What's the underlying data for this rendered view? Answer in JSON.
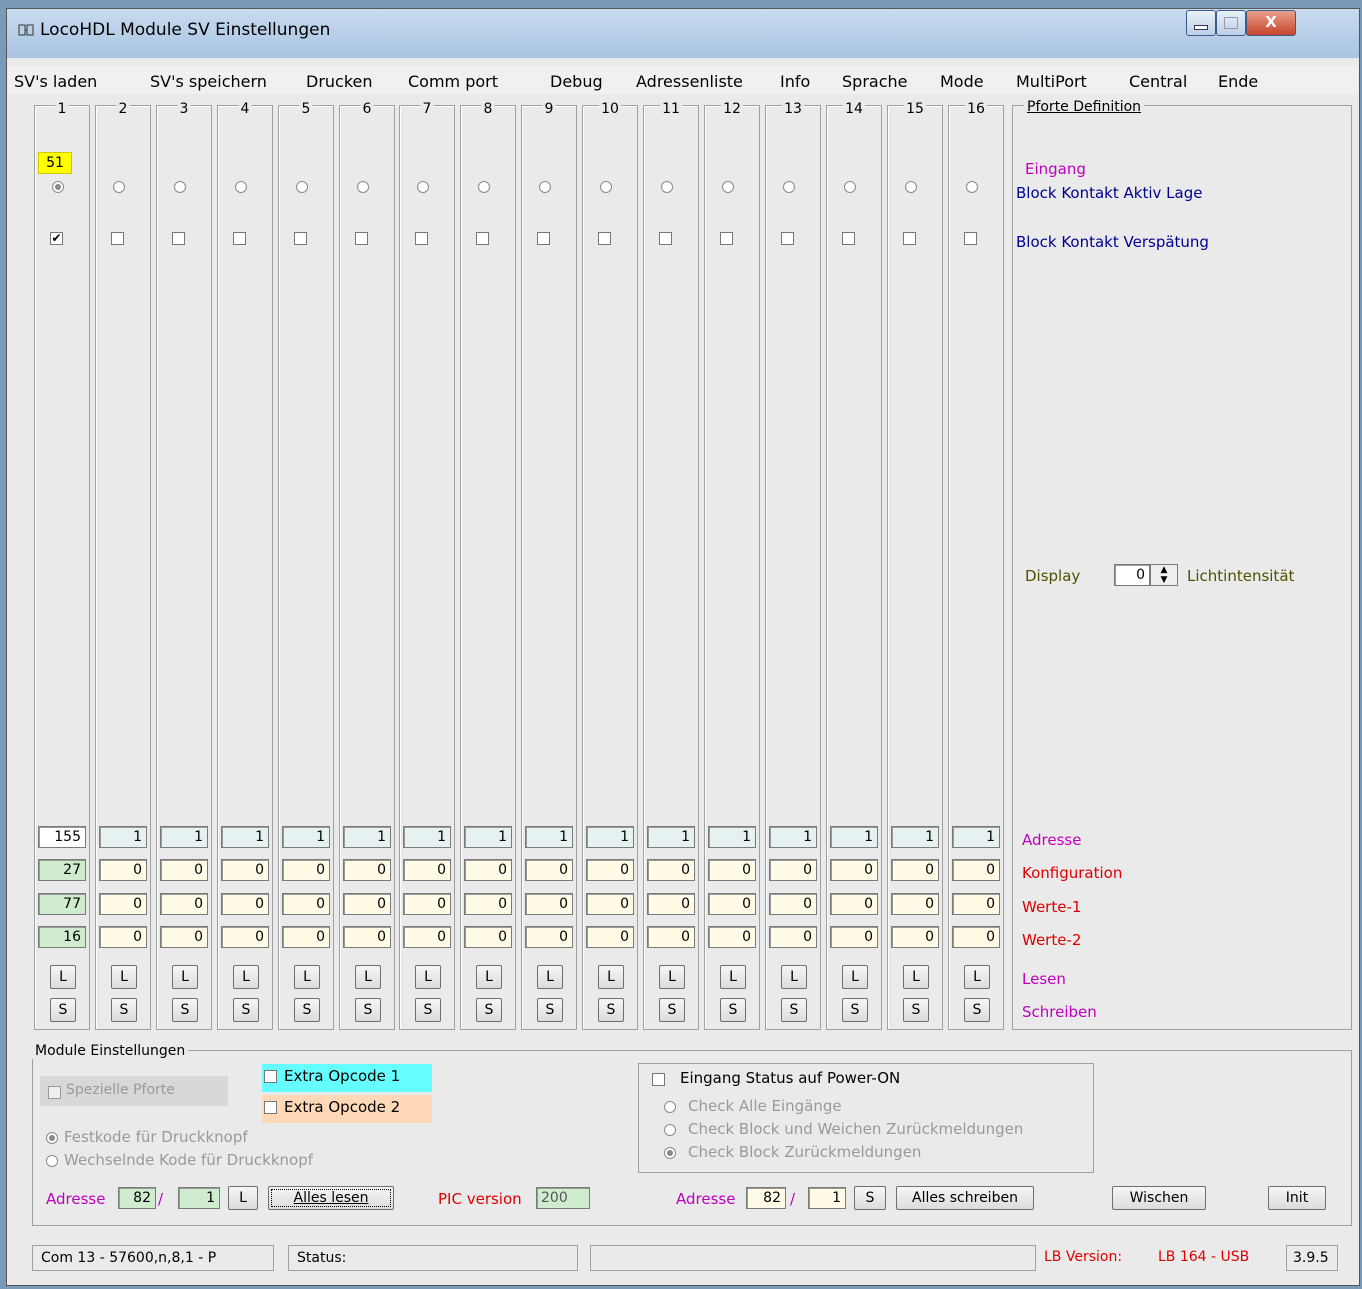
{
  "window": {
    "title": "LocoHDL Module SV Einstellungen",
    "close_label": "X"
  },
  "menu": [
    "SV's laden",
    "SV's speichern",
    "Drucken",
    "Comm port",
    "Debug",
    "Adressenliste",
    "Info",
    "Sprache",
    "Mode",
    "MultiPort",
    "Central",
    "Ende"
  ],
  "columns": [
    {
      "num": "1",
      "top_value": "51",
      "adresse": "155",
      "konfiguration": "27",
      "werte1": "77",
      "werte2": "16",
      "l": "L",
      "s": "S"
    },
    {
      "num": "2",
      "adresse": "1",
      "konfiguration": "0",
      "werte1": "0",
      "werte2": "0",
      "l": "L",
      "s": "S"
    },
    {
      "num": "3",
      "adresse": "1",
      "konfiguration": "0",
      "werte1": "0",
      "werte2": "0",
      "l": "L",
      "s": "S"
    },
    {
      "num": "4",
      "adresse": "1",
      "konfiguration": "0",
      "werte1": "0",
      "werte2": "0",
      "l": "L",
      "s": "S"
    },
    {
      "num": "5",
      "adresse": "1",
      "konfiguration": "0",
      "werte1": "0",
      "werte2": "0",
      "l": "L",
      "s": "S"
    },
    {
      "num": "6",
      "adresse": "1",
      "konfiguration": "0",
      "werte1": "0",
      "werte2": "0",
      "l": "L",
      "s": "S"
    },
    {
      "num": "7",
      "adresse": "1",
      "konfiguration": "0",
      "werte1": "0",
      "werte2": "0",
      "l": "L",
      "s": "S"
    },
    {
      "num": "8",
      "adresse": "1",
      "konfiguration": "0",
      "werte1": "0",
      "werte2": "0",
      "l": "L",
      "s": "S"
    },
    {
      "num": "9",
      "adresse": "1",
      "konfiguration": "0",
      "werte1": "0",
      "werte2": "0",
      "l": "L",
      "s": "S"
    },
    {
      "num": "10",
      "adresse": "1",
      "konfiguration": "0",
      "werte1": "0",
      "werte2": "0",
      "l": "L",
      "s": "S"
    },
    {
      "num": "11",
      "adresse": "1",
      "konfiguration": "0",
      "werte1": "0",
      "werte2": "0",
      "l": "L",
      "s": "S"
    },
    {
      "num": "12",
      "adresse": "1",
      "konfiguration": "0",
      "werte1": "0",
      "werte2": "0",
      "l": "L",
      "s": "S"
    },
    {
      "num": "13",
      "adresse": "1",
      "konfiguration": "0",
      "werte1": "0",
      "werte2": "0",
      "l": "L",
      "s": "S"
    },
    {
      "num": "14",
      "adresse": "1",
      "konfiguration": "0",
      "werte1": "0",
      "werte2": "0",
      "l": "L",
      "s": "S"
    },
    {
      "num": "15",
      "adresse": "1",
      "konfiguration": "0",
      "werte1": "0",
      "werte2": "0",
      "l": "L",
      "s": "S"
    },
    {
      "num": "16",
      "adresse": "1",
      "konfiguration": "0",
      "werte1": "0",
      "werte2": "0",
      "l": "L",
      "s": "S"
    }
  ],
  "port_def": {
    "title": "Pforte Definition",
    "eingang": "Eingang",
    "aktiv_lage": "Block Kontakt Aktiv Lage",
    "verspaetung": "Block Kontakt Verspätung",
    "display": "Display",
    "display_value": "0",
    "lichtintensitaet": "Lichtintensität",
    "adresse": "Adresse",
    "konfiguration": "Konfiguration",
    "werte1": "Werte-1",
    "werte2": "Werte-2",
    "lesen": "Lesen",
    "schreiben": "Schreiben"
  },
  "module": {
    "title": "Module Einstellungen",
    "spezielle": "Spezielle Pforte",
    "extra1": "Extra Opcode 1",
    "extra2": "Extra Opcode 2",
    "festkode": "Festkode für Druckknopf",
    "wechselnde": "Wechselnde Kode für Druckknopf",
    "power_on": "Eingang Status auf Power-ON",
    "check_alle": "Check Alle Eingänge",
    "check_block_weichen": "Check Block und Weichen Zurückmeldungen",
    "check_block": "Check Block Zurückmeldungen",
    "adresse_lbl": "Adresse",
    "adr1": "82",
    "sub1": "1",
    "l_btn": "L",
    "alles_lesen": "Alles lesen",
    "pic_label": "PIC version",
    "pic_value": "200",
    "adresse_lbl2": "Adresse",
    "adr2": "82",
    "sub2": "1",
    "s_btn": "S",
    "alles_schreiben": "Alles schreiben",
    "wischen": "Wischen",
    "init": "Init",
    "slash": "/"
  },
  "status": {
    "com": "Com 13 - 57600,n,8,1 - P",
    "status": "Status:",
    "lb_version_label": "LB Version:",
    "lb_version": "LB 164 - USB",
    "version": "3.9.5"
  },
  "colors": {
    "magenta": "#c000c0",
    "red": "#e00000",
    "navy": "#000090",
    "yellow": "#ffff00",
    "cyan": "#66ffff",
    "peach": "#ffd8b8"
  }
}
